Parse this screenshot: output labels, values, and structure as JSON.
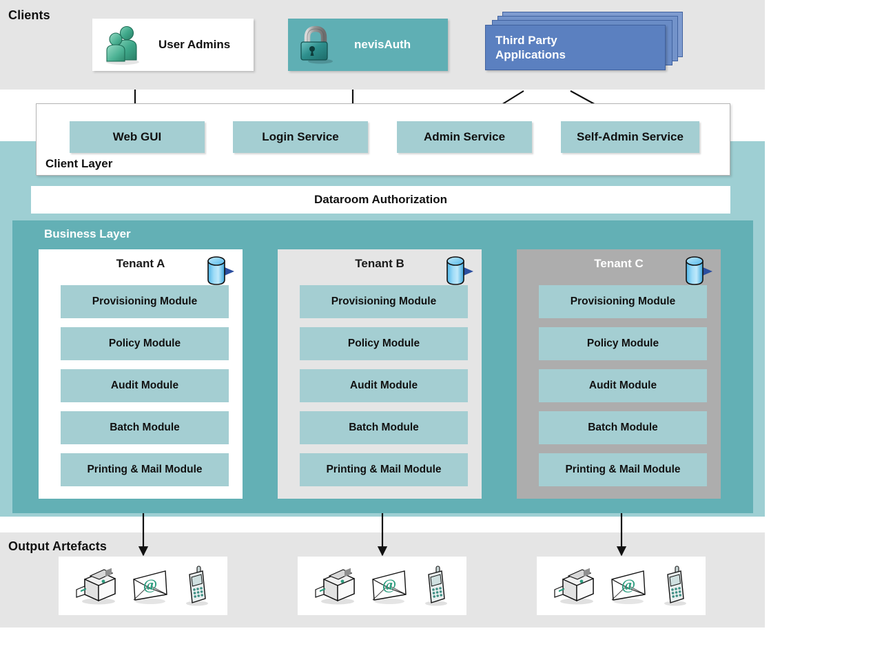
{
  "bands": {
    "clients_title": "Clients",
    "outputs_title": "Output Artefacts"
  },
  "clients": [
    {
      "label": "User Admins",
      "icon": "users-icon",
      "style": "white"
    },
    {
      "label": "nevisAuth",
      "icon": "padlock-icon",
      "style": "teal"
    },
    {
      "label": "Third Party Applications",
      "label_line1": "Third Party",
      "label_line2": "Applications",
      "icon": "stacked-apps-icon",
      "style": "blue-stack"
    }
  ],
  "client_layer": {
    "title": "Client Layer",
    "services": [
      {
        "label": "Web GUI"
      },
      {
        "label": "Login Service"
      },
      {
        "label": "Admin Service"
      },
      {
        "label": "Self-Admin Service"
      }
    ]
  },
  "dataroom": {
    "label": "Dataroom Authorization"
  },
  "business_layer": {
    "title": "Business Layer",
    "tenants": [
      {
        "name": "Tenant A",
        "style": "white",
        "db_icon": "database-cylinder-icon",
        "modules": [
          "Provisioning Module",
          "Policy Module",
          "Audit Module",
          "Batch Module",
          "Printing & Mail Module"
        ]
      },
      {
        "name": "Tenant B",
        "style": "grey-light",
        "db_icon": "database-cylinder-icon",
        "modules": [
          "Provisioning Module",
          "Policy Module",
          "Audit Module",
          "Batch Module",
          "Printing & Mail Module"
        ]
      },
      {
        "name": "Tenant C",
        "style": "grey-dark",
        "db_icon": "database-cylinder-icon",
        "modules": [
          "Provisioning Module",
          "Policy Module",
          "Audit Module",
          "Batch Module",
          "Printing & Mail Module"
        ]
      }
    ]
  },
  "outputs": {
    "groups": [
      {
        "icons": [
          "printer-icon",
          "email-envelope-icon",
          "mobile-phone-icon"
        ]
      },
      {
        "icons": [
          "printer-icon",
          "email-envelope-icon",
          "mobile-phone-icon"
        ]
      },
      {
        "icons": [
          "printer-icon",
          "email-envelope-icon",
          "mobile-phone-icon"
        ]
      }
    ]
  },
  "colors": {
    "band_grey": "#e5e5e5",
    "band_teal": "#9ecfd3",
    "business_teal": "#63b0b5",
    "module_teal": "#a4ced2",
    "client_teal": "#5fafb4",
    "third_party_blue": "#5b80c0",
    "tenant_c_grey": "#adadad",
    "accent_green": "#2f9e80"
  }
}
